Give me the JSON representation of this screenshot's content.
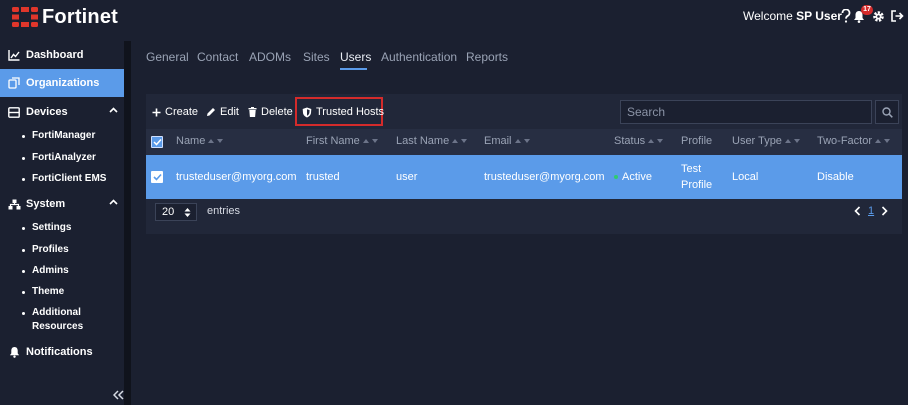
{
  "header": {
    "brand": "Fortinet",
    "welcome_prefix": "Welcome",
    "user_name": "SP User",
    "notification_count": "17",
    "icons": [
      "help-icon",
      "bell-icon",
      "gear-icon",
      "logout-icon"
    ]
  },
  "sidebar": {
    "items": [
      {
        "label": "Dashboard",
        "icon": "dashboard-icon"
      },
      {
        "label": "Organizations",
        "icon": "organizations-icon",
        "active": true
      },
      {
        "label": "Devices",
        "icon": "devices-icon",
        "expanded": true
      },
      {
        "label": "System",
        "icon": "system-icon",
        "expanded": true
      },
      {
        "label": "Notifications",
        "icon": "bell-icon"
      }
    ],
    "devices_children": [
      "FortiManager",
      "FortiAnalyzer",
      "FortiClient EMS"
    ],
    "system_children": [
      "Settings",
      "Profiles",
      "Admins",
      "Theme",
      "Additional Resources"
    ]
  },
  "tabs": [
    {
      "label": "General"
    },
    {
      "label": "Contact"
    },
    {
      "label": "ADOMs"
    },
    {
      "label": "Sites"
    },
    {
      "label": "Users",
      "active": true
    },
    {
      "label": "Authentication"
    },
    {
      "label": "Reports"
    }
  ],
  "toolbar": {
    "create": "Create",
    "edit": "Edit",
    "delete": "Delete",
    "trusted_hosts": "Trusted Hosts",
    "highlight_color": "#d42b2b"
  },
  "search": {
    "placeholder": "Search",
    "value": ""
  },
  "table": {
    "columns": [
      "Name",
      "First Name",
      "Last Name",
      "Email",
      "Status",
      "Profile",
      "User Type",
      "Two-Factor"
    ],
    "rows": [
      {
        "selected": true,
        "name": "trusteduser@myorg.com",
        "first_name": "trusted",
        "last_name": "user",
        "email": "trusteduser@myorg.com",
        "status": "Active",
        "profile_line1": "Test",
        "profile_line2": "Profile",
        "user_type": "Local",
        "two_factor": "Disable"
      }
    ]
  },
  "footer": {
    "page_size": "20",
    "entries_label": "entries",
    "current_page": "1"
  },
  "colors": {
    "accent": "#5b9be9",
    "background": "#1b2030",
    "panel": "#212739",
    "status_active": "#2ecc71"
  }
}
